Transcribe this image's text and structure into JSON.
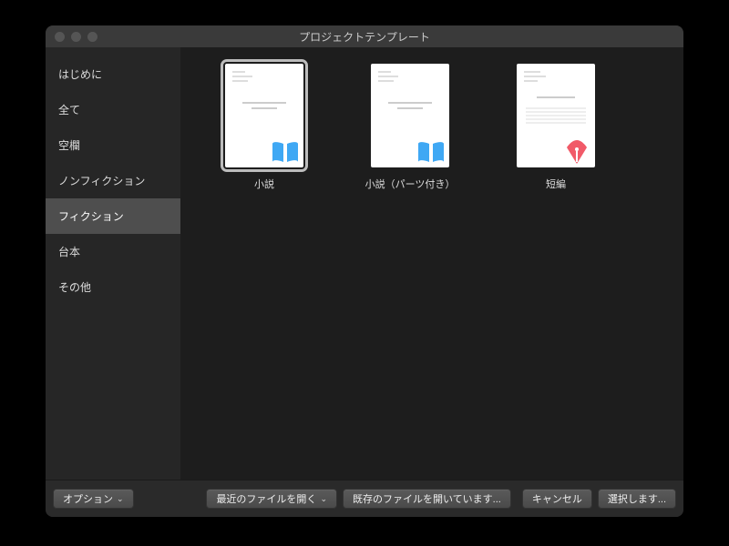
{
  "window_title": "プロジェクトテンプレート",
  "sidebar": {
    "items": [
      {
        "label": "はじめに"
      },
      {
        "label": "全て"
      },
      {
        "label": "空欄"
      },
      {
        "label": "ノンフィクション"
      },
      {
        "label": "フィクション",
        "selected": true
      },
      {
        "label": "台本"
      },
      {
        "label": "その他"
      }
    ]
  },
  "templates": [
    {
      "label": "小説",
      "icon": "book",
      "icon_color": "#3fa8f4",
      "selected": true
    },
    {
      "label": "小説（パーツ付き）",
      "icon": "book",
      "icon_color": "#3fa8f4",
      "selected": false
    },
    {
      "label": "短編",
      "icon": "pen",
      "icon_color": "#f15a68",
      "selected": false
    }
  ],
  "footer": {
    "options": "オプション",
    "open_recent": "最近のファイルを開く",
    "open_existing": "既存のファイルを開いています...",
    "cancel": "キャンセル",
    "choose": "選択します..."
  },
  "glyphs": {
    "dropdown": "⌄"
  }
}
